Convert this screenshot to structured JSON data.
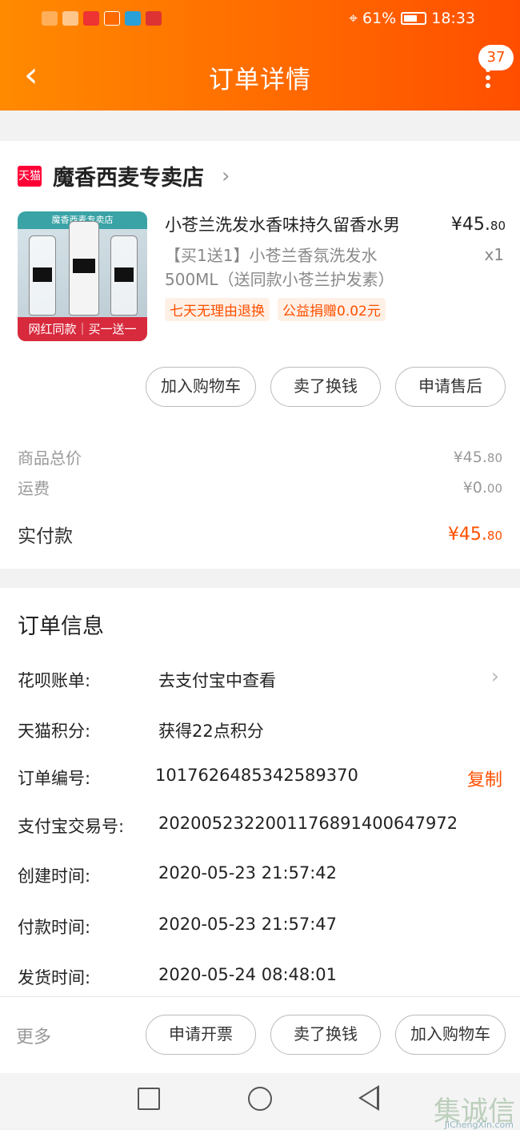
{
  "statusbar": {
    "battery": "61%",
    "time": "18:33"
  },
  "header": {
    "title": "订单详情",
    "badge": "37"
  },
  "shop": {
    "platform_logo": "天猫",
    "name": "魔香西麦专卖店"
  },
  "product": {
    "image_top_text": "魔香西麦专卖店",
    "image_bottom_text": "网红同款｜买一送一",
    "title": "小苍兰洗发水香味持久留香水男",
    "price_main": "¥45.",
    "price_cents": "80",
    "sku": "【买1送1】小苍兰香氛洗发水500ML（送同款小苍兰护发素）",
    "qty": "x1",
    "tags": [
      "七天无理由退换",
      "公益捐赠0.02元"
    ]
  },
  "actions": [
    "加入购物车",
    "卖了换钱",
    "申请售后"
  ],
  "summary": {
    "goods_label": "商品总价",
    "goods_main": "¥45.",
    "goods_cents": "80",
    "shipping_label": "运费",
    "shipping_main": "¥0.",
    "shipping_cents": "00",
    "paid_label": "实付款",
    "paid_main": "¥45.",
    "paid_cents": "80"
  },
  "order_info": {
    "title": "订单信息",
    "rows": [
      {
        "label": "花呗账单:",
        "value": "去支付宝中查看"
      },
      {
        "label": "天猫积分:",
        "value": "获得22点积分"
      },
      {
        "label": "订单编号:",
        "value": "1017626485342589370"
      },
      {
        "label": "支付宝交易号:",
        "value": "2020052322001176891400647972"
      },
      {
        "label": "创建时间:",
        "value": "2020-05-23 21:57:42"
      },
      {
        "label": "付款时间:",
        "value": "2020-05-23 21:57:47"
      },
      {
        "label": "发货时间:",
        "value": "2020-05-24 08:48:01"
      }
    ],
    "copy_label": "复制"
  },
  "bottom": {
    "more_label": "更多",
    "buttons": [
      "申请开票",
      "卖了换钱",
      "加入购物车"
    ]
  },
  "watermark": {
    "text": "集诚信",
    "sub": "JiChengXin.com"
  },
  "colors": {
    "accent": "#ff5000",
    "header_start": "#ff8a00",
    "header_end": "#ff4e00"
  }
}
